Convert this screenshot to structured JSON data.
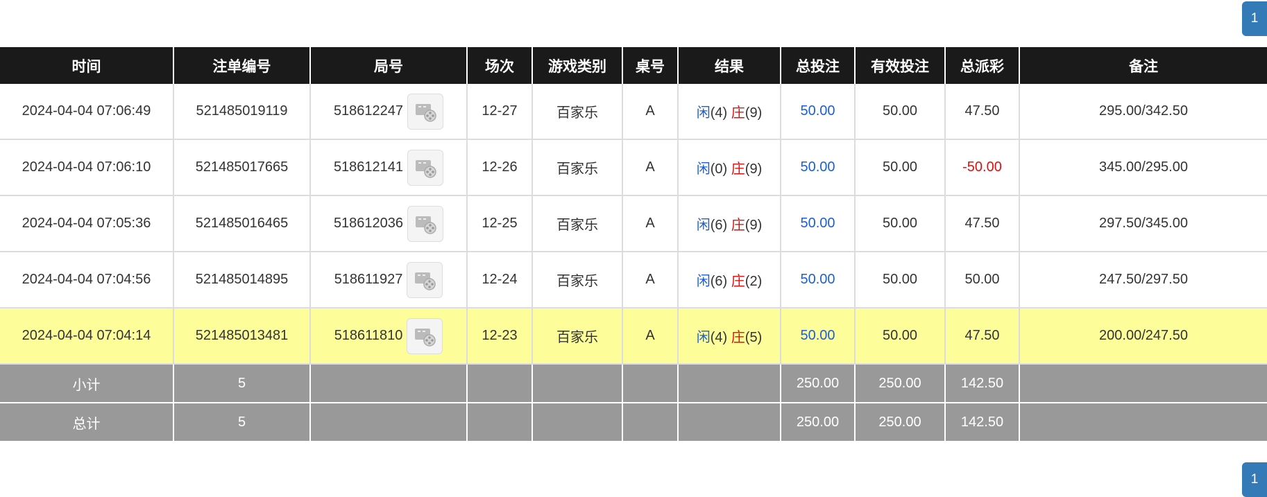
{
  "pagination": {
    "top_page": "1",
    "bottom_page": "1"
  },
  "headers": [
    "时间",
    "注单编号",
    "局号",
    "场次",
    "游戏类别",
    "桌号",
    "结果",
    "总投注",
    "有效投注",
    "总派彩",
    "备注"
  ],
  "rows": [
    {
      "time": "2024-04-04 07:06:49",
      "order_no": "521485019119",
      "round_no": "518612247",
      "session": "12-27",
      "game": "百家乐",
      "table": "A",
      "player_label": "闲",
      "player_val": "(4)",
      "banker_label": "庄",
      "banker_val": "(9)",
      "total_bet": "50.00",
      "valid_bet": "50.00",
      "payout": "47.50",
      "note": "295.00/342.50"
    },
    {
      "time": "2024-04-04 07:06:10",
      "order_no": "521485017665",
      "round_no": "518612141",
      "session": "12-26",
      "game": "百家乐",
      "table": "A",
      "player_label": "闲",
      "player_val": "(0)",
      "banker_label": "庄",
      "banker_val": "(9)",
      "total_bet": "50.00",
      "valid_bet": "50.00",
      "payout": "-50.00",
      "note": "345.00/295.00"
    },
    {
      "time": "2024-04-04 07:05:36",
      "order_no": "521485016465",
      "round_no": "518612036",
      "session": "12-25",
      "game": "百家乐",
      "table": "A",
      "player_label": "闲",
      "player_val": "(6)",
      "banker_label": "庄",
      "banker_val": "(9)",
      "total_bet": "50.00",
      "valid_bet": "50.00",
      "payout": "47.50",
      "note": "297.50/345.00"
    },
    {
      "time": "2024-04-04 07:04:56",
      "order_no": "521485014895",
      "round_no": "518611927",
      "session": "12-24",
      "game": "百家乐",
      "table": "A",
      "player_label": "闲",
      "player_val": "(6)",
      "banker_label": "庄",
      "banker_val": "(2)",
      "total_bet": "50.00",
      "valid_bet": "50.00",
      "payout": "50.00",
      "note": "247.50/297.50"
    },
    {
      "time": "2024-04-04 07:04:14",
      "order_no": "521485013481",
      "round_no": "518611810",
      "session": "12-23",
      "game": "百家乐",
      "table": "A",
      "player_label": "闲",
      "player_val": "(4)",
      "banker_label": "庄",
      "banker_val": "(5)",
      "total_bet": "50.00",
      "valid_bet": "50.00",
      "payout": "47.50",
      "note": "200.00/247.50"
    }
  ],
  "subtotal": {
    "label": "小计",
    "count": "5",
    "total_bet": "250.00",
    "valid_bet": "250.00",
    "payout": "142.50"
  },
  "grand_total": {
    "label": "总计",
    "count": "5",
    "total_bet": "250.00",
    "valid_bet": "250.00",
    "payout": "142.50"
  },
  "colors": {
    "header_bg": "#1a1a1a",
    "footer_bg": "#999999",
    "highlight_row": "#fdfd99",
    "blue": "#1a5fd8",
    "red": "#e01010",
    "pager": "#337ab7"
  },
  "icons": {
    "video": "video-replay-icon"
  }
}
